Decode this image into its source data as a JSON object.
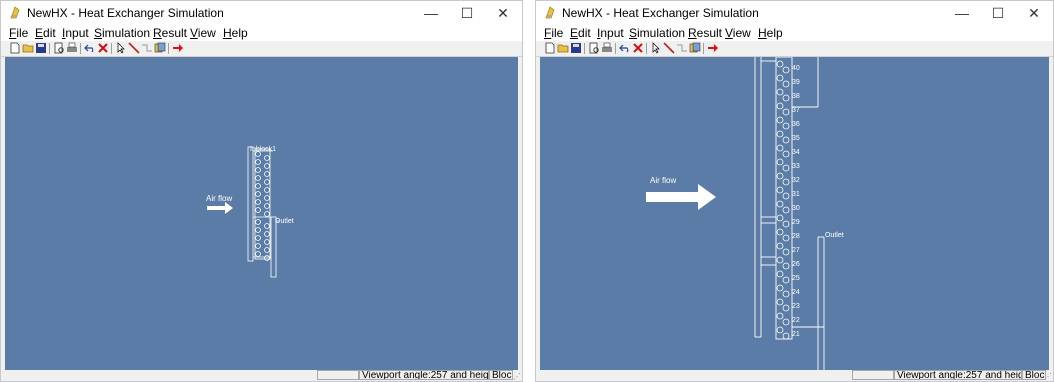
{
  "windows": [
    {
      "title": "NewHX - Heat Exchanger Simulation",
      "controls": {
        "minimize": "—",
        "maximize": "☐",
        "close": "✕"
      },
      "menu": [
        "File",
        "Edit",
        "Input",
        "Simulation",
        "Result",
        "View",
        "Help"
      ],
      "toolbar": [
        "new-file",
        "open-folder",
        "save",
        "print-preview",
        "print",
        "undo",
        "delete",
        "select-pointer",
        "draw-line",
        "connect",
        "stack",
        "run"
      ],
      "canvas": {
        "air_flow_label": "Air flow",
        "outlet_label": "Outlet",
        "top_label": "Inblock1"
      },
      "status": {
        "left": "",
        "main": "Viewport angle:257 and heig",
        "right": "Bloc"
      }
    },
    {
      "title": "NewHX - Heat Exchanger Simulation",
      "controls": {
        "minimize": "—",
        "maximize": "☐",
        "close": "✕"
      },
      "menu": [
        "File",
        "Edit",
        "Input",
        "Simulation",
        "Result",
        "View",
        "Help"
      ],
      "toolbar": [
        "new-file",
        "open-folder",
        "save",
        "print-preview",
        "print",
        "undo",
        "delete",
        "select-pointer",
        "draw-line",
        "connect",
        "stack",
        "run"
      ],
      "canvas": {
        "air_flow_label": "Air flow",
        "outlet_label": "Outlet",
        "tube_numbers": [
          "40",
          "39",
          "38",
          "37",
          "36",
          "35",
          "34",
          "33",
          "32",
          "31",
          "30",
          "29",
          "28",
          "27",
          "26",
          "25",
          "24",
          "23",
          "22",
          "21"
        ]
      },
      "status": {
        "left": "",
        "main": "Viewport angle:257 and heig",
        "right": "Bloc"
      }
    }
  ],
  "colors": {
    "viewport": "#5a7ca6",
    "drawing": "#ffffff",
    "run_arrow": "#e01010",
    "delete": "#d01010"
  }
}
